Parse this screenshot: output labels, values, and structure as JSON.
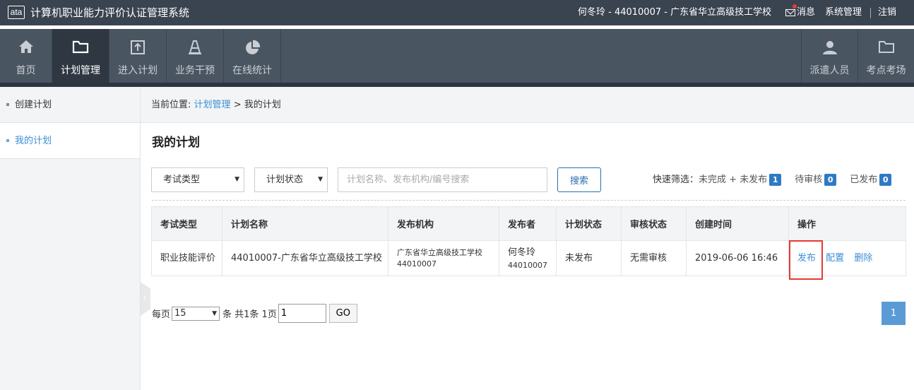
{
  "header": {
    "logo_text": "ata",
    "app_title": "计算机职业能力评价认证管理系统",
    "user_info": "何冬玲 - 44010007 - 广东省华立高级技工学校",
    "messages_label": "消息",
    "system_label": "系统管理",
    "logout_label": "注销"
  },
  "nav": {
    "items": [
      {
        "label": "首页",
        "icon": "home-icon"
      },
      {
        "label": "计划管理",
        "icon": "folder-icon"
      },
      {
        "label": "进入计划",
        "icon": "upload-icon"
      },
      {
        "label": "业务干预",
        "icon": "cone-icon"
      },
      {
        "label": "在线统计",
        "icon": "pie-chart-icon"
      }
    ],
    "right_items": [
      {
        "label": "派遣人员",
        "icon": "user-icon"
      },
      {
        "label": "考点考场",
        "icon": "folder-icon"
      }
    ]
  },
  "sidebar": {
    "items": [
      {
        "label": "创建计划"
      },
      {
        "label": "我的计划"
      }
    ]
  },
  "breadcrumb": {
    "prefix": "当前位置:",
    "link": "计划管理",
    "sep": ">",
    "current": "我的计划"
  },
  "page_title": "我的计划",
  "filters": {
    "exam_type": "考试类型",
    "plan_status": "计划状态",
    "search_placeholder": "计划名称、发布机构/编号搜索",
    "search_button": "搜索",
    "quick_label": "快速筛选：",
    "quick_options": [
      {
        "label": "未完成 + 未发布",
        "count": "1"
      },
      {
        "label": "待审核",
        "count": "0"
      },
      {
        "label": "已发布",
        "count": "0"
      }
    ]
  },
  "table": {
    "headers": [
      "考试类型",
      "计划名称",
      "发布机构",
      "发布者",
      "计划状态",
      "审核状态",
      "创建时间",
      "操作"
    ],
    "rows": [
      {
        "exam_type": "职业技能评价",
        "plan_name": "44010007-广东省华立高级技工学校",
        "org_name": "广东省华立高级技工学校",
        "org_code": "44010007",
        "publisher_name": "何冬玲",
        "publisher_code": "44010007",
        "plan_status": "未发布",
        "review_status": "无需审核",
        "created": "2019-06-06 16:46",
        "actions": {
          "publish": "发布",
          "config": "配置",
          "delete": "删除"
        }
      }
    ]
  },
  "pager": {
    "per_page_label": "每页",
    "per_page_value": "15",
    "summary": "条 共1条 1页",
    "page_input": "1",
    "go_label": "GO",
    "current_page": "1"
  }
}
